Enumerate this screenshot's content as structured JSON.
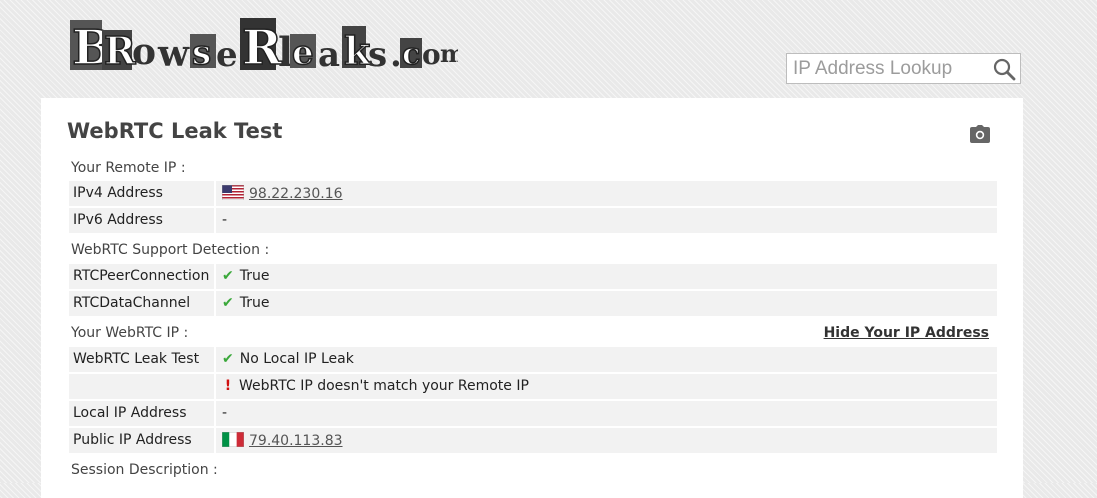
{
  "header": {
    "logo_text": "BrowserLeaks.com",
    "search": {
      "placeholder": "IP Address Lookup",
      "value": ""
    }
  },
  "page": {
    "title": "WebRTC Leak Test",
    "sections": {
      "remote_ip": "Your Remote IP :",
      "support": "WebRTC Support Detection :",
      "webrtc_ip": "Your WebRTC IP :",
      "session": "Session Description :"
    },
    "hide_ip_link": "Hide Your IP Address",
    "rows": {
      "ipv4": {
        "label": "IPv4 Address",
        "value": "98.22.230.16",
        "flag": "US"
      },
      "ipv6": {
        "label": "IPv6 Address",
        "value": "-"
      },
      "peer": {
        "label": "RTCPeerConnection",
        "value": "True"
      },
      "datachannel": {
        "label": "RTCDataChannel",
        "value": "True"
      },
      "leak": {
        "label": "WebRTC Leak Test",
        "value": "No Local IP Leak",
        "value2": "WebRTC IP doesn't match your Remote IP"
      },
      "local_ip": {
        "label": "Local IP Address",
        "value": "-"
      },
      "public_ip": {
        "label": "Public IP Address",
        "value": "79.40.113.83",
        "flag": "IT"
      }
    }
  },
  "colors": {
    "check": "#3aa83a",
    "warning": "#d01010",
    "panel": "#ffffff",
    "row_bg": "#f2f2f2"
  },
  "icons": {
    "search": "search-icon",
    "camera": "camera-icon",
    "check": "check-icon",
    "warning": "exclamation-icon"
  }
}
